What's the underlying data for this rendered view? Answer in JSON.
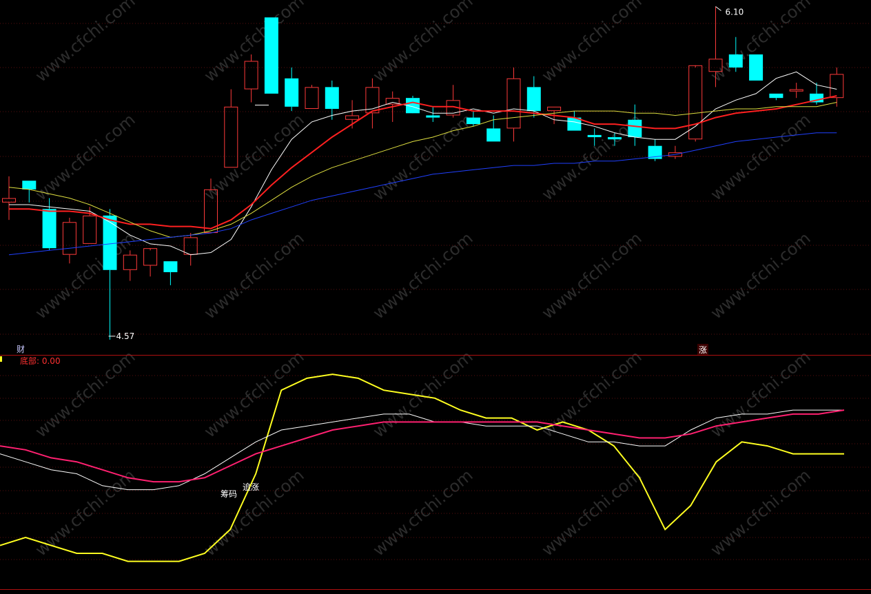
{
  "chart_data": [
    {
      "type": "candlestick",
      "title": "",
      "candles": [
        {
          "o": 5.2,
          "h": 5.32,
          "l": 5.12,
          "c": 5.22,
          "color": "up"
        },
        {
          "o": 5.3,
          "h": 5.3,
          "l": 5.2,
          "c": 5.26,
          "color": "down"
        },
        {
          "o": 5.17,
          "h": 5.22,
          "l": 4.98,
          "c": 4.99,
          "color": "down"
        },
        {
          "o": 4.96,
          "h": 5.13,
          "l": 4.92,
          "c": 5.11,
          "color": "up"
        },
        {
          "o": 5.01,
          "h": 5.18,
          "l": 5.01,
          "c": 5.14,
          "color": "up"
        },
        {
          "o": 5.14,
          "h": 5.17,
          "l": 4.57,
          "c": 4.89,
          "color": "down"
        },
        {
          "o": 4.89,
          "h": 4.98,
          "l": 4.84,
          "c": 4.96,
          "color": "up"
        },
        {
          "o": 4.91,
          "h": 4.98,
          "l": 4.86,
          "c": 4.99,
          "color": "up"
        },
        {
          "o": 4.93,
          "h": 4.93,
          "l": 4.82,
          "c": 4.88,
          "color": "down"
        },
        {
          "o": 4.96,
          "h": 5.06,
          "l": 4.91,
          "c": 5.04,
          "color": "up"
        },
        {
          "o": 5.06,
          "h": 5.31,
          "l": 5.06,
          "c": 5.26,
          "color": "up"
        },
        {
          "o": 5.36,
          "h": 5.72,
          "l": 5.36,
          "c": 5.64,
          "color": "up"
        },
        {
          "o": 5.72,
          "h": 5.88,
          "l": 5.66,
          "c": 5.85,
          "color": "up"
        },
        {
          "o": 6.05,
          "h": 6.05,
          "l": 5.7,
          "c": 5.7,
          "color": "down"
        },
        {
          "o": 5.77,
          "h": 5.82,
          "l": 5.62,
          "c": 5.64,
          "color": "down"
        },
        {
          "o": 5.63,
          "h": 5.74,
          "l": 5.63,
          "c": 5.73,
          "color": "up"
        },
        {
          "o": 5.73,
          "h": 5.76,
          "l": 5.58,
          "c": 5.63,
          "color": "down"
        },
        {
          "o": 5.58,
          "h": 5.67,
          "l": 5.54,
          "c": 5.6,
          "color": "up"
        },
        {
          "o": 5.61,
          "h": 5.77,
          "l": 5.54,
          "c": 5.73,
          "color": "up"
        },
        {
          "o": 5.65,
          "h": 5.71,
          "l": 5.57,
          "c": 5.68,
          "color": "up"
        },
        {
          "o": 5.68,
          "h": 5.69,
          "l": 5.63,
          "c": 5.61,
          "color": "down"
        },
        {
          "o": 5.6,
          "h": 5.64,
          "l": 5.57,
          "c": 5.59,
          "color": "down"
        },
        {
          "o": 5.6,
          "h": 5.74,
          "l": 5.59,
          "c": 5.67,
          "color": "up"
        },
        {
          "o": 5.59,
          "h": 5.62,
          "l": 5.55,
          "c": 5.56,
          "color": "down"
        },
        {
          "o": 5.54,
          "h": 5.6,
          "l": 5.48,
          "c": 5.48,
          "color": "down"
        },
        {
          "o": 5.54,
          "h": 5.82,
          "l": 5.48,
          "c": 5.77,
          "color": "up"
        },
        {
          "o": 5.73,
          "h": 5.78,
          "l": 5.59,
          "c": 5.62,
          "color": "down"
        },
        {
          "o": 5.62,
          "h": 5.64,
          "l": 5.56,
          "c": 5.64,
          "color": "up"
        },
        {
          "o": 5.59,
          "h": 5.62,
          "l": 5.53,
          "c": 5.53,
          "color": "down"
        },
        {
          "o": 5.5,
          "h": 5.54,
          "l": 5.46,
          "c": 5.51,
          "color": "down"
        },
        {
          "o": 5.5,
          "h": 5.52,
          "l": 5.46,
          "c": 5.49,
          "color": "down"
        },
        {
          "o": 5.58,
          "h": 5.65,
          "l": 5.46,
          "c": 5.5,
          "color": "down"
        },
        {
          "o": 5.46,
          "h": 5.49,
          "l": 5.39,
          "c": 5.4,
          "color": "down"
        },
        {
          "o": 5.43,
          "h": 5.46,
          "l": 5.4,
          "c": 5.41,
          "color": "up"
        },
        {
          "o": 5.49,
          "h": 5.82,
          "l": 5.48,
          "c": 5.83,
          "color": "up"
        },
        {
          "o": 5.8,
          "h": 6.1,
          "l": 5.73,
          "c": 5.86,
          "color": "up"
        },
        {
          "o": 5.88,
          "h": 5.96,
          "l": 5.8,
          "c": 5.82,
          "color": "down"
        },
        {
          "o": 5.88,
          "h": 5.88,
          "l": 5.76,
          "c": 5.76,
          "color": "down"
        },
        {
          "o": 5.7,
          "h": 5.7,
          "l": 5.67,
          "c": 5.68,
          "color": "down"
        },
        {
          "o": 5.71,
          "h": 5.75,
          "l": 5.68,
          "c": 5.72,
          "color": "up"
        },
        {
          "o": 5.7,
          "h": 5.75,
          "l": 5.65,
          "c": 5.66,
          "color": "down"
        },
        {
          "o": 5.68,
          "h": 5.82,
          "l": 5.64,
          "c": 5.79,
          "color": "up"
        }
      ],
      "ma_lines": [
        {
          "name": "",
          "color": "#ffffff",
          "values": [
            5.19,
            5.19,
            5.18,
            5.17,
            5.16,
            5.11,
            5.05,
            5.01,
            5.0,
            4.96,
            4.97,
            5.03,
            5.18,
            5.35,
            5.49,
            5.57,
            5.6,
            5.62,
            5.63,
            5.66,
            5.64,
            5.61,
            5.61,
            5.63,
            5.61,
            5.63,
            5.62,
            5.58,
            5.57,
            5.55,
            5.52,
            5.5,
            5.49,
            5.49,
            5.55,
            5.63,
            5.67,
            5.7,
            5.77,
            5.8,
            5.74,
            5.72
          ]
        },
        {
          "name": "",
          "color": "#ff2020",
          "values": [
            5.17,
            5.17,
            5.16,
            5.16,
            5.15,
            5.12,
            5.1,
            5.1,
            5.09,
            5.09,
            5.08,
            5.12,
            5.19,
            5.28,
            5.36,
            5.43,
            5.5,
            5.56,
            5.62,
            5.64,
            5.66,
            5.64,
            5.64,
            5.62,
            5.62,
            5.62,
            5.61,
            5.6,
            5.59,
            5.56,
            5.56,
            5.55,
            5.54,
            5.54,
            5.56,
            5.59,
            5.61,
            5.62,
            5.63,
            5.65,
            5.67,
            5.69
          ]
        },
        {
          "name": "",
          "color": "#e0e040",
          "values": [
            5.27,
            5.26,
            5.24,
            5.22,
            5.19,
            5.15,
            5.11,
            5.07,
            5.04,
            5.05,
            5.07,
            5.1,
            5.15,
            5.21,
            5.27,
            5.32,
            5.36,
            5.39,
            5.42,
            5.45,
            5.48,
            5.5,
            5.53,
            5.55,
            5.58,
            5.59,
            5.6,
            5.61,
            5.62,
            5.62,
            5.62,
            5.61,
            5.61,
            5.6,
            5.61,
            5.62,
            5.63,
            5.63,
            5.64,
            5.64,
            5.64,
            5.66
          ]
        },
        {
          "name": "",
          "color": "#2040ff",
          "values": [
            4.96,
            4.97,
            4.98,
            4.99,
            5.0,
            5.01,
            5.02,
            5.03,
            5.04,
            5.05,
            5.06,
            5.08,
            5.12,
            5.15,
            5.18,
            5.21,
            5.23,
            5.25,
            5.27,
            5.29,
            5.31,
            5.33,
            5.34,
            5.35,
            5.36,
            5.37,
            5.37,
            5.38,
            5.38,
            5.39,
            5.39,
            5.4,
            5.41,
            5.42,
            5.44,
            5.46,
            5.48,
            5.49,
            5.5,
            5.51,
            5.52,
            5.52
          ]
        }
      ],
      "ylim": [
        4.5,
        6.13
      ],
      "annotations": [
        {
          "text": "6.10",
          "index": 35,
          "value": 6.1
        },
        {
          "text": "4.57",
          "index": 5,
          "value": 4.57
        },
        {
          "text": "财",
          "index": 1,
          "value": 4.52
        },
        {
          "text": "涨",
          "index": 34,
          "value": 4.52
        }
      ]
    },
    {
      "type": "line",
      "legend_text": "底部: 0.00",
      "series": [
        {
          "name": "",
          "color": "#ffff20",
          "values": [
            5,
            7,
            5,
            3,
            3,
            1,
            1,
            1,
            3,
            9,
            23,
            44,
            47,
            48,
            47,
            44,
            43,
            42,
            39,
            37,
            37,
            34,
            36,
            34,
            30,
            22,
            9,
            15,
            26,
            31,
            30,
            28,
            28,
            28
          ]
        },
        {
          "name": "",
          "color": "#ffffff",
          "values": [
            28,
            26,
            24,
            23,
            20,
            19,
            19,
            20,
            23,
            27,
            31,
            34,
            35,
            36,
            37,
            38,
            38,
            36,
            36,
            35,
            35,
            35,
            33,
            31,
            31,
            30,
            30,
            34,
            37,
            38,
            38,
            39,
            39,
            39
          ]
        },
        {
          "name": "",
          "color": "#ff2070",
          "values": [
            30,
            29,
            27,
            26,
            24,
            22,
            21,
            21,
            22,
            25,
            28,
            30,
            32,
            34,
            35,
            36,
            36,
            36,
            36,
            36,
            36,
            36,
            35,
            34,
            33,
            32,
            32,
            33,
            35,
            36,
            37,
            38,
            38,
            39
          ]
        }
      ],
      "ylim": [
        -6,
        52
      ],
      "annotations": [
        {
          "text": "筹码",
          "index": 10,
          "value": 19
        },
        {
          "text": "追涨",
          "index": 11,
          "value": 20
        }
      ]
    }
  ],
  "watermark": "www.cfchi.com"
}
